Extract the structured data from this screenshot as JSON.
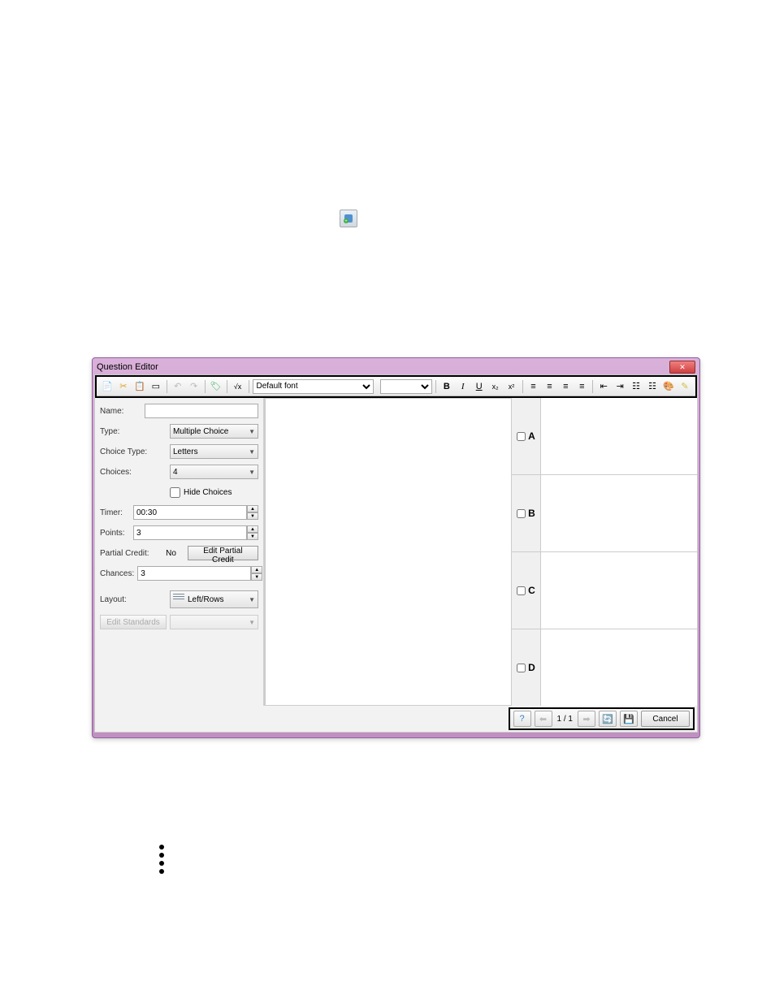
{
  "dialog": {
    "title": "Question Editor"
  },
  "toolbar": {
    "font": "Default font",
    "fontsize": ""
  },
  "props": {
    "name_label": "Name:",
    "name_value": "",
    "type_label": "Type:",
    "type_value": "Multiple Choice",
    "choicetype_label": "Choice Type:",
    "choicetype_value": "Letters",
    "choices_label": "Choices:",
    "choices_value": "4",
    "hide_choices_label": "Hide Choices",
    "timer_label": "Timer:",
    "timer_value": "00:30",
    "points_label": "Points:",
    "points_value": "3",
    "partial_label": "Partial Credit:",
    "partial_value": "No",
    "partial_button": "Edit Partial Credit",
    "chances_label": "Chances:",
    "chances_value": "3",
    "layout_label": "Layout:",
    "layout_value": "Left/Rows",
    "standards_button": "Edit Standards"
  },
  "choices": {
    "a": "A",
    "b": "B",
    "c": "C",
    "d": "D"
  },
  "footer": {
    "page": "1 / 1",
    "cancel": "Cancel"
  }
}
